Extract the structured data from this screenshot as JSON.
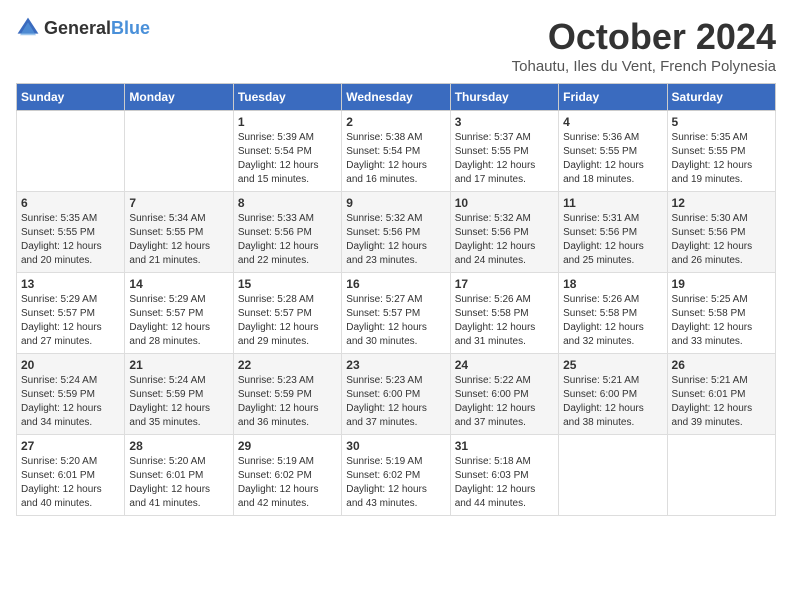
{
  "logo": {
    "general": "General",
    "blue": "Blue"
  },
  "title": {
    "month": "October 2024",
    "location": "Tohautu, Iles du Vent, French Polynesia"
  },
  "days_of_week": [
    "Sunday",
    "Monday",
    "Tuesday",
    "Wednesday",
    "Thursday",
    "Friday",
    "Saturday"
  ],
  "weeks": [
    [
      {
        "day": "",
        "info": ""
      },
      {
        "day": "",
        "info": ""
      },
      {
        "day": "1",
        "info": "Sunrise: 5:39 AM\nSunset: 5:54 PM\nDaylight: 12 hours and 15 minutes."
      },
      {
        "day": "2",
        "info": "Sunrise: 5:38 AM\nSunset: 5:54 PM\nDaylight: 12 hours and 16 minutes."
      },
      {
        "day": "3",
        "info": "Sunrise: 5:37 AM\nSunset: 5:55 PM\nDaylight: 12 hours and 17 minutes."
      },
      {
        "day": "4",
        "info": "Sunrise: 5:36 AM\nSunset: 5:55 PM\nDaylight: 12 hours and 18 minutes."
      },
      {
        "day": "5",
        "info": "Sunrise: 5:35 AM\nSunset: 5:55 PM\nDaylight: 12 hours and 19 minutes."
      }
    ],
    [
      {
        "day": "6",
        "info": "Sunrise: 5:35 AM\nSunset: 5:55 PM\nDaylight: 12 hours and 20 minutes."
      },
      {
        "day": "7",
        "info": "Sunrise: 5:34 AM\nSunset: 5:55 PM\nDaylight: 12 hours and 21 minutes."
      },
      {
        "day": "8",
        "info": "Sunrise: 5:33 AM\nSunset: 5:56 PM\nDaylight: 12 hours and 22 minutes."
      },
      {
        "day": "9",
        "info": "Sunrise: 5:32 AM\nSunset: 5:56 PM\nDaylight: 12 hours and 23 minutes."
      },
      {
        "day": "10",
        "info": "Sunrise: 5:32 AM\nSunset: 5:56 PM\nDaylight: 12 hours and 24 minutes."
      },
      {
        "day": "11",
        "info": "Sunrise: 5:31 AM\nSunset: 5:56 PM\nDaylight: 12 hours and 25 minutes."
      },
      {
        "day": "12",
        "info": "Sunrise: 5:30 AM\nSunset: 5:56 PM\nDaylight: 12 hours and 26 minutes."
      }
    ],
    [
      {
        "day": "13",
        "info": "Sunrise: 5:29 AM\nSunset: 5:57 PM\nDaylight: 12 hours and 27 minutes."
      },
      {
        "day": "14",
        "info": "Sunrise: 5:29 AM\nSunset: 5:57 PM\nDaylight: 12 hours and 28 minutes."
      },
      {
        "day": "15",
        "info": "Sunrise: 5:28 AM\nSunset: 5:57 PM\nDaylight: 12 hours and 29 minutes."
      },
      {
        "day": "16",
        "info": "Sunrise: 5:27 AM\nSunset: 5:57 PM\nDaylight: 12 hours and 30 minutes."
      },
      {
        "day": "17",
        "info": "Sunrise: 5:26 AM\nSunset: 5:58 PM\nDaylight: 12 hours and 31 minutes."
      },
      {
        "day": "18",
        "info": "Sunrise: 5:26 AM\nSunset: 5:58 PM\nDaylight: 12 hours and 32 minutes."
      },
      {
        "day": "19",
        "info": "Sunrise: 5:25 AM\nSunset: 5:58 PM\nDaylight: 12 hours and 33 minutes."
      }
    ],
    [
      {
        "day": "20",
        "info": "Sunrise: 5:24 AM\nSunset: 5:59 PM\nDaylight: 12 hours and 34 minutes."
      },
      {
        "day": "21",
        "info": "Sunrise: 5:24 AM\nSunset: 5:59 PM\nDaylight: 12 hours and 35 minutes."
      },
      {
        "day": "22",
        "info": "Sunrise: 5:23 AM\nSunset: 5:59 PM\nDaylight: 12 hours and 36 minutes."
      },
      {
        "day": "23",
        "info": "Sunrise: 5:23 AM\nSunset: 6:00 PM\nDaylight: 12 hours and 37 minutes."
      },
      {
        "day": "24",
        "info": "Sunrise: 5:22 AM\nSunset: 6:00 PM\nDaylight: 12 hours and 37 minutes."
      },
      {
        "day": "25",
        "info": "Sunrise: 5:21 AM\nSunset: 6:00 PM\nDaylight: 12 hours and 38 minutes."
      },
      {
        "day": "26",
        "info": "Sunrise: 5:21 AM\nSunset: 6:01 PM\nDaylight: 12 hours and 39 minutes."
      }
    ],
    [
      {
        "day": "27",
        "info": "Sunrise: 5:20 AM\nSunset: 6:01 PM\nDaylight: 12 hours and 40 minutes."
      },
      {
        "day": "28",
        "info": "Sunrise: 5:20 AM\nSunset: 6:01 PM\nDaylight: 12 hours and 41 minutes."
      },
      {
        "day": "29",
        "info": "Sunrise: 5:19 AM\nSunset: 6:02 PM\nDaylight: 12 hours and 42 minutes."
      },
      {
        "day": "30",
        "info": "Sunrise: 5:19 AM\nSunset: 6:02 PM\nDaylight: 12 hours and 43 minutes."
      },
      {
        "day": "31",
        "info": "Sunrise: 5:18 AM\nSunset: 6:03 PM\nDaylight: 12 hours and 44 minutes."
      },
      {
        "day": "",
        "info": ""
      },
      {
        "day": "",
        "info": ""
      }
    ]
  ]
}
